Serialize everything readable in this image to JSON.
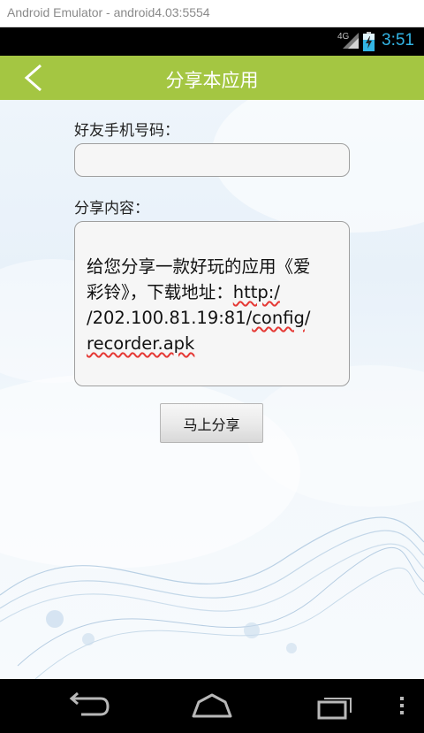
{
  "emulator": {
    "title": "Android Emulator - android4.03:5554"
  },
  "status_bar": {
    "network": "4G",
    "time": "3:51",
    "icons": [
      "signal-icon",
      "battery-charging-icon"
    ],
    "clock_color": "#33b5e5"
  },
  "app_bar": {
    "title": "分享本应用",
    "back_icon": "chevron-left-icon",
    "color": "#a4c642"
  },
  "form": {
    "phone_label": "好友手机号码：",
    "phone_value": "",
    "content_label": "分享内容：",
    "content_lines": [
      "给您分享一款好玩的应用《爱",
      "彩铃》，下载地址："
    ],
    "content_url_parts": [
      "http:/",
      "/202.100.81.19:81/",
      "config",
      "/",
      "recorder.apk"
    ],
    "share_button": "马上分享"
  },
  "nav_bar": {
    "icons": [
      "back-arrow-icon",
      "home-icon",
      "recent-apps-icon",
      "overflow-menu-icon"
    ]
  }
}
